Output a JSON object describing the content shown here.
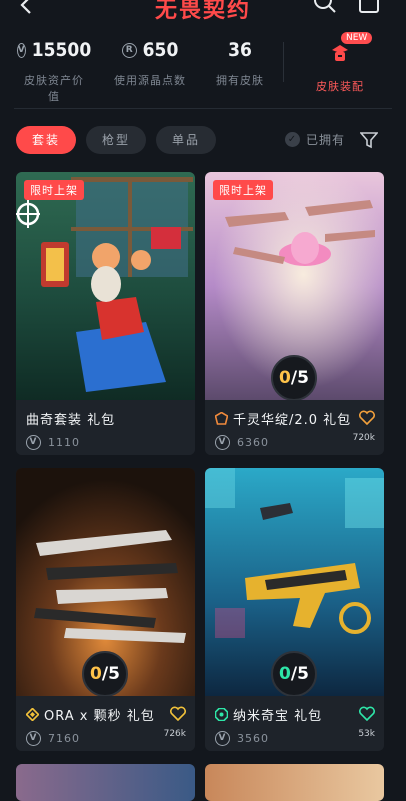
{
  "header": {
    "title": "无畏契约"
  },
  "stats": [
    {
      "value": "15500",
      "label": "皮肤资产价值",
      "coin": "V"
    },
    {
      "value": "650",
      "label": "使用源晶点数",
      "coin": "R"
    },
    {
      "value": "36",
      "label": "拥有皮肤"
    }
  ],
  "outfit_entry": {
    "label": "皮肤装配",
    "badge": "NEW"
  },
  "tabs": [
    "套装",
    "枪型",
    "单品"
  ],
  "owned_filter": {
    "label": "已拥有"
  },
  "cards": [
    {
      "limited": "限时上架",
      "name": "曲奇套装 礼包",
      "price": "1110",
      "likes": "",
      "owned": "",
      "total": "",
      "tier": ""
    },
    {
      "limited": "限时上架",
      "name": "千灵华绽/2.0 礼包",
      "price": "6360",
      "likes": "720k",
      "owned": "0",
      "total": "/5",
      "tier": "orange"
    },
    {
      "limited": "",
      "name": "ORA x 颗秒 礼包",
      "price": "7160",
      "likes": "726k",
      "owned": "0",
      "total": "/5",
      "tier": "yellow"
    },
    {
      "limited": "",
      "name": "纳米奇宝 礼包",
      "price": "3560",
      "likes": "53k",
      "owned": "0",
      "total": "/5",
      "tier": "green"
    }
  ],
  "colors": {
    "accent": "#ff4a4a",
    "background": "#13171d",
    "card": "#1e232a"
  }
}
